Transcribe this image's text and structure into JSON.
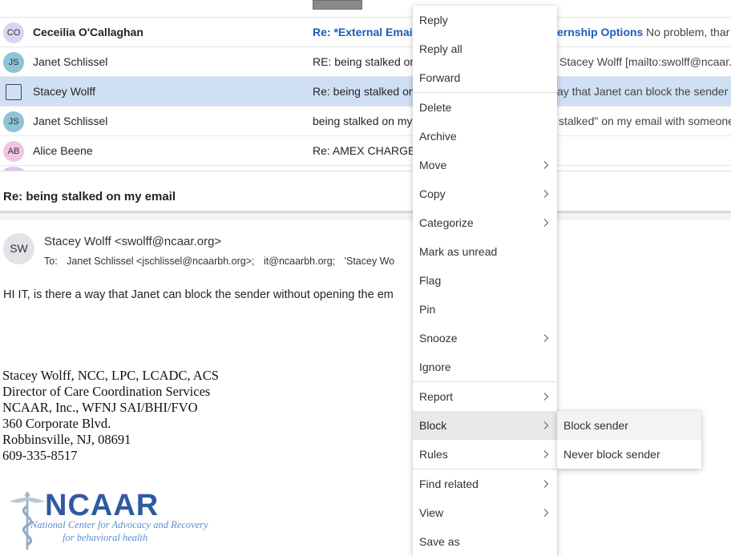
{
  "colors": {
    "selected_row": "#cfe0f5",
    "link_blue": "#1c5db8",
    "menu_hover": "#e9e9e9",
    "logo_blue": "#2f5aa0"
  },
  "message_list": {
    "rows": [
      {
        "initials": "CO",
        "avatar_color": "#dcd3f3",
        "sender": "Ceceilia O'Callaghan",
        "subject": "Re: *External Email*...",
        "preview_highlight": "ernship Options",
        "preview": "No problem, thar"
      },
      {
        "initials": "JS",
        "avatar_color": "#8fc3d6",
        "sender": "Janet Schlissel",
        "subject": "RE: being stalked on",
        "preview": "Stacey Wolff [mailto:swolff@ncaar."
      },
      {
        "initials": "",
        "avatar_color": "",
        "sender": "Stacey Wolff",
        "subject": "Re: being stalked on",
        "preview": "ay that Janet can block the sender w"
      },
      {
        "initials": "JS",
        "avatar_color": "#8fc3d6",
        "sender": "Janet Schlissel",
        "subject": "being stalked on my",
        "preview": "stalked\" on my email with someone"
      },
      {
        "initials": "AB",
        "avatar_color": "#f2c6e3",
        "sender": "Alice Beene",
        "subject": "Re: AMEX CHARGE",
        "preview": ""
      }
    ]
  },
  "reading_pane": {
    "title": "Re: being stalked on my email",
    "from_initials": "SW",
    "from": "Stacey Wolff <swolff@ncaar.org>",
    "to_label": "To:",
    "recipients": [
      "Janet Schlissel <jschlissel@ncaarbh.org>;",
      "it@ncaarbh.org;",
      "'Stacey Wo"
    ],
    "body": "HI IT, is there a way that Janet can block the sender without opening the em",
    "signature": [
      "Stacey Wolff, NCC, LPC, LCADC, ACS",
      "Director of Care Coordination Services",
      "NCAAR, Inc., WFNJ SAI/BHI/FVO",
      "360 Corporate Blvd.",
      "Robbinsville, NJ, 08691",
      "609-335-8517"
    ],
    "logo": {
      "wordmark": "NCAAR",
      "line1": "National Center for Advocacy and Recovery",
      "line2": "for behavioral health"
    }
  },
  "context_menu": {
    "items": [
      {
        "label": "Reply",
        "submenu": false
      },
      {
        "label": "Reply all",
        "submenu": false
      },
      {
        "label": "Forward",
        "submenu": false
      },
      {
        "label": "Delete",
        "submenu": false
      },
      {
        "label": "Archive",
        "submenu": false
      },
      {
        "label": "Move",
        "submenu": true
      },
      {
        "label": "Copy",
        "submenu": true
      },
      {
        "label": "Categorize",
        "submenu": true
      },
      {
        "label": "Mark as unread",
        "submenu": false
      },
      {
        "label": "Flag",
        "submenu": false
      },
      {
        "label": "Pin",
        "submenu": false
      },
      {
        "label": "Snooze",
        "submenu": true
      },
      {
        "label": "Ignore",
        "submenu": false
      },
      {
        "label": "Report",
        "submenu": true
      },
      {
        "label": "Block",
        "submenu": true
      },
      {
        "label": "Rules",
        "submenu": true
      },
      {
        "label": "Find related",
        "submenu": true
      },
      {
        "label": "View",
        "submenu": true
      },
      {
        "label": "Save as",
        "submenu": false
      }
    ],
    "active_item": "Block"
  },
  "block_submenu": {
    "items": [
      {
        "label": "Block sender"
      },
      {
        "label": "Never block sender"
      }
    ]
  }
}
